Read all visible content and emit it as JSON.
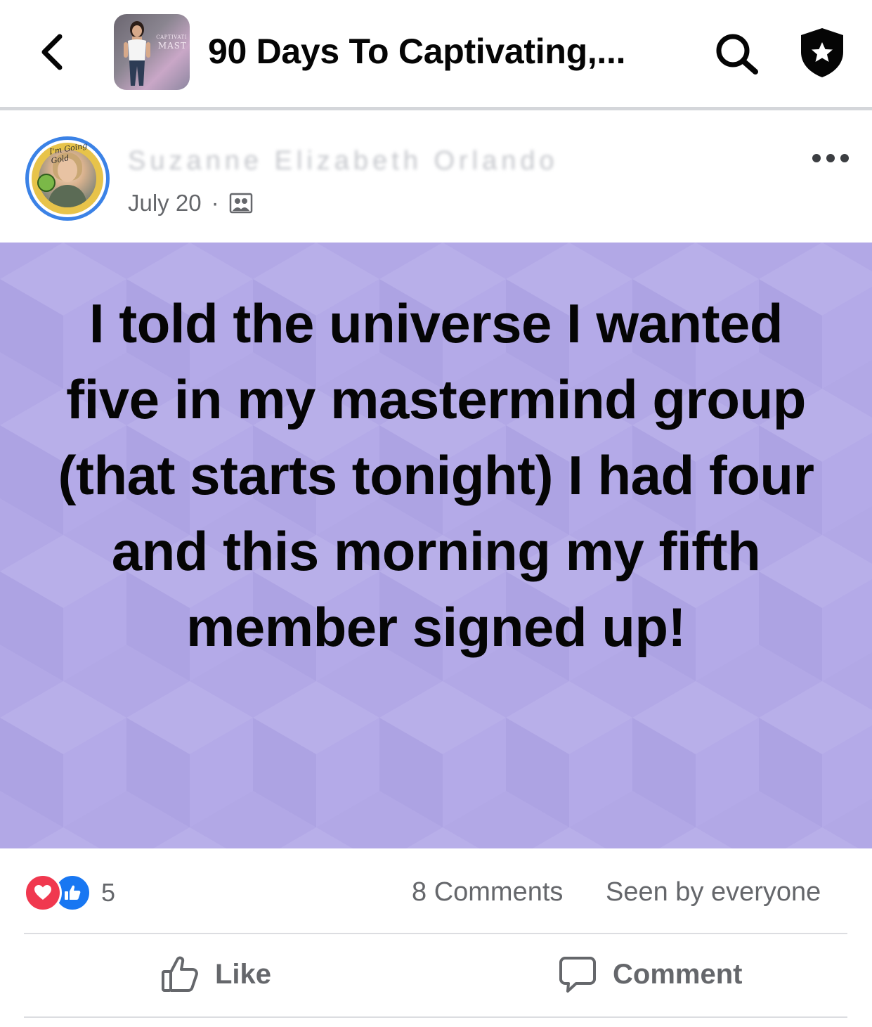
{
  "header": {
    "back_icon": "chevron-left-icon",
    "group_title": "90 Days To Captivating,...",
    "group_thumb_text_small": "CAPTIVATI",
    "group_thumb_text_large": "MAST",
    "search_icon": "search-icon",
    "admin_icon": "shield-star-icon"
  },
  "post": {
    "author_name": "Suzanne Elizabeth Orlando",
    "date": "July 20",
    "separator": "·",
    "audience_icon": "group-members-icon",
    "more_icon": "more-dots-icon",
    "avatar_banner": "I'm Going Gold",
    "text": "I told the universe I wanted five in my mastermind group (that starts tonight) I had four and this morning my fifth member signed up!",
    "background_color": "#b2a8e6"
  },
  "stats": {
    "reaction_icons": [
      "love-reaction-icon",
      "like-reaction-icon"
    ],
    "reaction_count": "5",
    "comments": "8 Comments",
    "seen_by": "Seen by everyone"
  },
  "actions": {
    "like_label": "Like",
    "comment_label": "Comment"
  },
  "colors": {
    "accent_blue": "#1877f2",
    "love_red": "#f0384f",
    "muted_text": "#65676b"
  }
}
